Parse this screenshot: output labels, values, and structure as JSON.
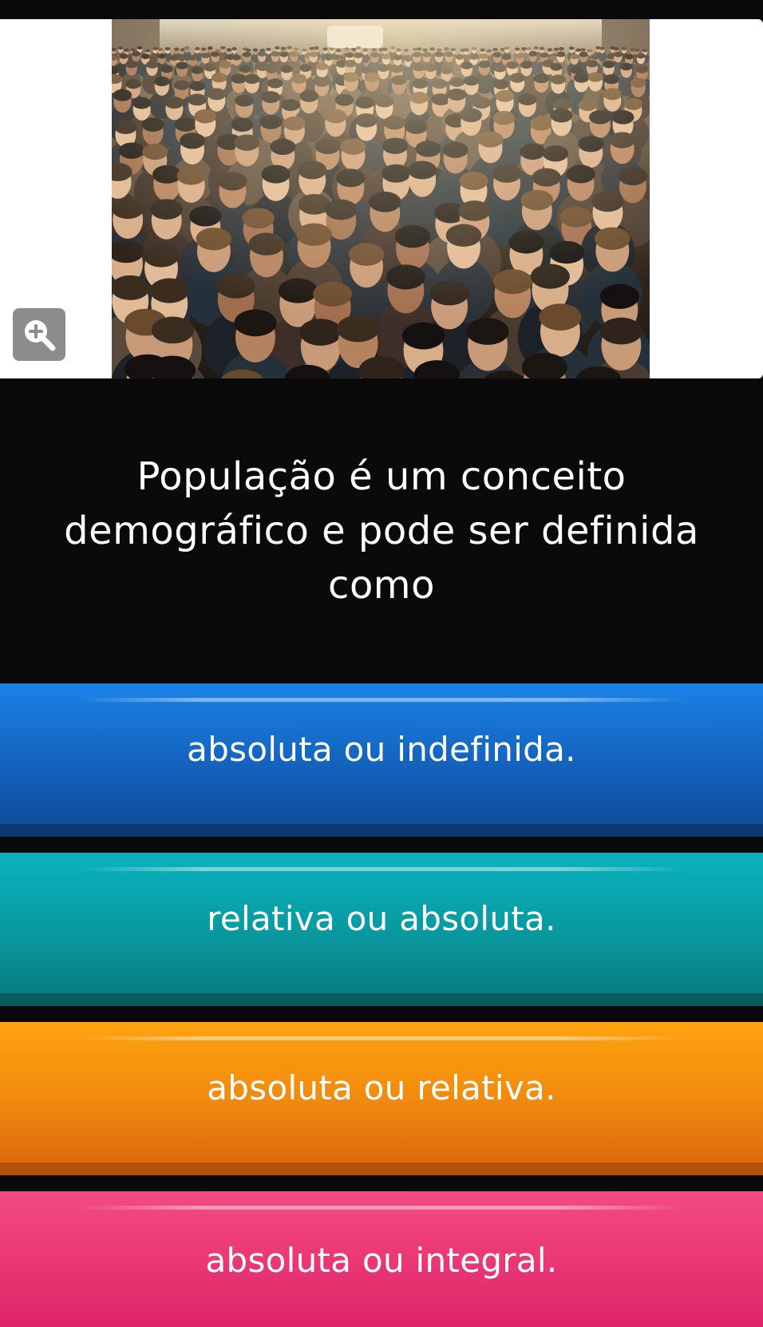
{
  "media": {
    "image_alt": "",
    "zoom_icon": "zoom-in-icon"
  },
  "question": {
    "text": "População é um conceito demográfico e pode ser definida como"
  },
  "options": [
    {
      "label": "absoluta ou indefinida.",
      "color": "#1565c8"
    },
    {
      "label": "relativa ou absoluta.",
      "color": "#089aa0"
    },
    {
      "label": "absoluta ou relativa.",
      "color": "#f18a0e"
    },
    {
      "label": "absoluta ou integral.",
      "color": "#ea3674"
    }
  ]
}
